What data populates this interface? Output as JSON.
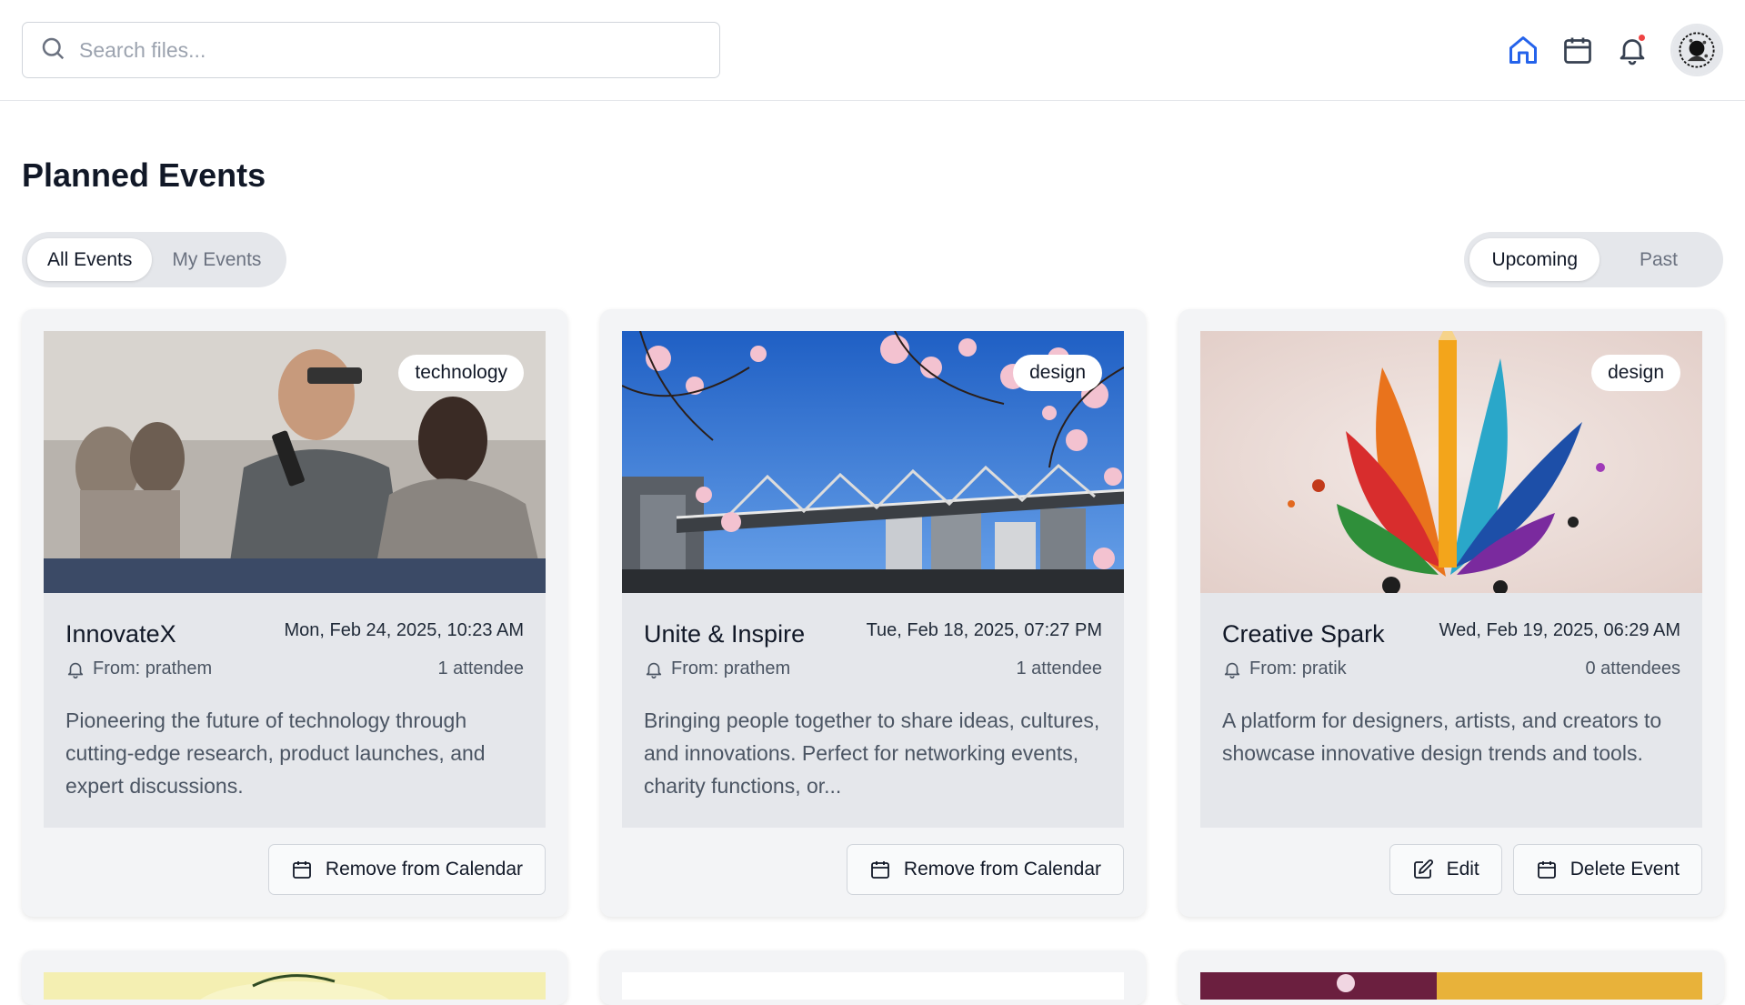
{
  "header": {
    "search_placeholder": "Search files...",
    "icons": [
      "home-icon",
      "calendar-icon",
      "bell-icon"
    ],
    "accent_color": "#2563eb",
    "notification_dot_color": "#ef4444"
  },
  "page": {
    "title": "Planned Events"
  },
  "filters": {
    "scope": {
      "options": [
        "All Events",
        "My Events"
      ],
      "selected": "All Events"
    },
    "time": {
      "options": [
        "Upcoming",
        "Past"
      ],
      "selected": "Upcoming"
    }
  },
  "events": [
    {
      "title": "InnovateX",
      "date": "Mon, Feb 24, 2025, 10:23 AM",
      "tag": "technology",
      "from": "From: prathem",
      "attendees": "1 attendee",
      "description": "Pioneering the future of technology through cutting-edge research, product launches, and expert discussions.",
      "actions": [
        "Remove from Calendar"
      ]
    },
    {
      "title": "Unite & Inspire",
      "date": "Tue, Feb 18, 2025, 07:27 PM",
      "tag": "design",
      "from": "From: prathem",
      "attendees": "1 attendee",
      "description": "Bringing people together to share ideas, cultures, and innovations. Perfect for networking events, charity functions, or...",
      "actions": [
        "Remove from Calendar"
      ]
    },
    {
      "title": "Creative Spark",
      "date": "Wed, Feb 19, 2025, 06:29 AM",
      "tag": "design",
      "from": "From: pratik",
      "attendees": "0 attendees",
      "description": "A platform for designers, artists, and creators to showcase innovative design trends and tools.",
      "actions": [
        "Edit",
        "Delete Event"
      ]
    }
  ]
}
